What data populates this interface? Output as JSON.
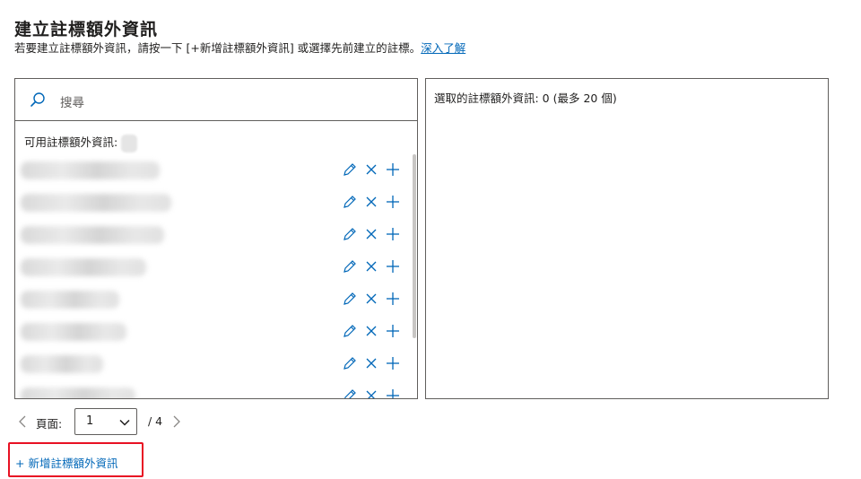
{
  "header": {
    "title": "建立註標額外資訊",
    "subtitle": "若要建立註標額外資訊，請按一下 [+新增註標額外資訊] 或選擇先前建立的註標。",
    "learn_more": "深入了解"
  },
  "search": {
    "placeholder": "搜尋",
    "icon": "search-icon"
  },
  "available": {
    "label": "可用註標額外資訊:",
    "items": [
      {
        "name": "",
        "actions": [
          "edit-icon",
          "delete-icon",
          "add-icon"
        ]
      },
      {
        "name": "",
        "actions": [
          "edit-icon",
          "delete-icon",
          "add-icon"
        ]
      },
      {
        "name": "",
        "actions": [
          "edit-icon",
          "delete-icon",
          "add-icon"
        ]
      },
      {
        "name": "",
        "actions": [
          "edit-icon",
          "delete-icon",
          "add-icon"
        ]
      },
      {
        "name": "",
        "actions": [
          "edit-icon",
          "delete-icon",
          "add-icon"
        ]
      },
      {
        "name": "",
        "actions": [
          "edit-icon",
          "delete-icon",
          "add-icon"
        ]
      },
      {
        "name": "",
        "actions": [
          "edit-icon",
          "delete-icon",
          "add-icon"
        ]
      },
      {
        "name": "",
        "actions": [
          "edit-icon",
          "delete-icon",
          "add-icon"
        ]
      }
    ]
  },
  "selected": {
    "label": "選取的註標額外資訊:  0 (最多 20 個)"
  },
  "pager": {
    "label": "頁面:",
    "current": "1",
    "total": "/ 4"
  },
  "add_button": {
    "label": "+ 新增註標額外資訊"
  },
  "colors": {
    "accent": "#0067b8",
    "highlight_border": "#e81123",
    "border": "#605e5c"
  }
}
